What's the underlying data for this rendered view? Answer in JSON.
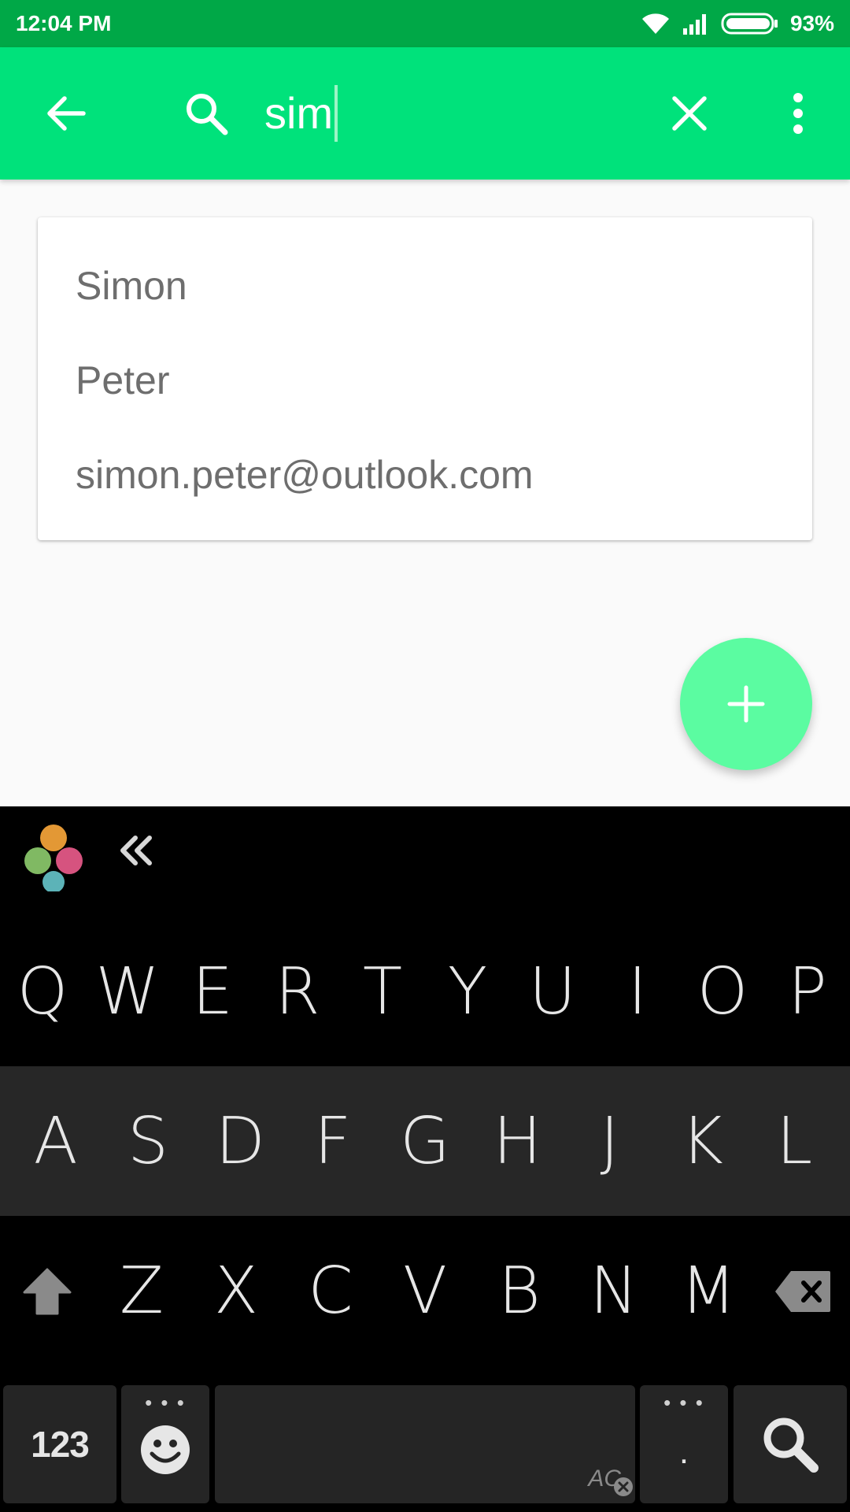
{
  "status_bar": {
    "time": "12:04 PM",
    "battery": "93%"
  },
  "search": {
    "query": "sim"
  },
  "results": [
    {
      "text": "Simon"
    },
    {
      "text": "Peter"
    },
    {
      "text": "simon.peter@outlook.com"
    }
  ],
  "keyboard": {
    "row1": [
      "Q",
      "W",
      "E",
      "R",
      "T",
      "Y",
      "U",
      "I",
      "O",
      "P"
    ],
    "row2": [
      "A",
      "S",
      "D",
      "F",
      "G",
      "H",
      "J",
      "K",
      "L"
    ],
    "row3": [
      "Z",
      "X",
      "C",
      "V",
      "B",
      "N",
      "M"
    ],
    "numbers_label": "123",
    "period_label": ".",
    "space_badge": "AC"
  },
  "colors": {
    "status_bar": "#00a847",
    "app_bar": "#00e27b",
    "fab": "#5bfca1"
  },
  "icons": {
    "back": "arrow-left-icon",
    "search": "search-icon",
    "clear": "close-icon",
    "more": "more-vert-icon",
    "fab": "plus-icon",
    "shift": "shift-arrow-icon",
    "backspace": "backspace-icon",
    "emoji": "smiley-icon",
    "submit": "search-icon"
  }
}
